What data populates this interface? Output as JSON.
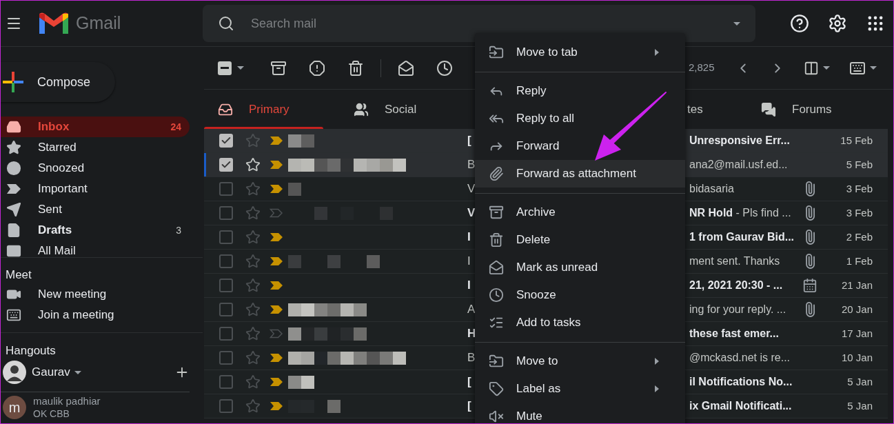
{
  "header": {
    "app_name": "Gmail",
    "search": {
      "placeholder": "Search mail"
    }
  },
  "compose": {
    "label": "Compose"
  },
  "nav": [
    {
      "label": "Inbox",
      "count": "24",
      "selected": true,
      "bold": true
    },
    {
      "label": "Starred",
      "selected": false,
      "bold": false
    },
    {
      "label": "Snoozed",
      "selected": false,
      "bold": false
    },
    {
      "label": "Important",
      "selected": false,
      "bold": false
    },
    {
      "label": "Sent",
      "selected": false,
      "bold": false
    },
    {
      "label": "Drafts",
      "count": "3",
      "selected": false,
      "bold": true
    },
    {
      "label": "All Mail",
      "selected": false,
      "bold": false
    }
  ],
  "meet": {
    "title": "Meet",
    "items": [
      {
        "label": "New meeting"
      },
      {
        "label": "Join a meeting"
      }
    ]
  },
  "hangouts": {
    "title": "Hangouts",
    "user": "Gaurav",
    "contacts": [
      {
        "name": "maulik padhiar",
        "status": "OK CBB",
        "initial": "m"
      }
    ]
  },
  "toolbar": {
    "partially_selected": true,
    "count": "2,825"
  },
  "tabs": [
    {
      "label": "Primary",
      "selected": true
    },
    {
      "label": "Social",
      "selected": false
    },
    {
      "label": "tes",
      "selected": false
    },
    {
      "label": "Forums",
      "selected": false
    }
  ],
  "emails": [
    {
      "checked": true,
      "focused": false,
      "important": true,
      "unread": true,
      "lead": "[",
      "text": "Unresponsive Err...",
      "date": "15 Feb"
    },
    {
      "checked": true,
      "focused": true,
      "important": true,
      "unread": false,
      "lead": "B",
      "text": "ana2@mail.usf.ed...",
      "date": "5 Feb"
    },
    {
      "checked": false,
      "focused": false,
      "important": true,
      "unread": false,
      "lead": "V",
      "text": "bidasaria",
      "has_attachment": true,
      "date": "3 Feb"
    },
    {
      "checked": false,
      "focused": false,
      "important": false,
      "unread": true,
      "lead": "V",
      "text": "NR Hold",
      "snippet": " - Pls find ...",
      "has_attachment": true,
      "date": "3 Feb"
    },
    {
      "checked": false,
      "focused": false,
      "important": true,
      "unread": true,
      "lead": "I",
      "text": "1 from Gaurav Bid...",
      "has_attachment": true,
      "date": "2 Feb"
    },
    {
      "checked": false,
      "focused": false,
      "important": true,
      "unread": false,
      "lead": "I",
      "text": "ment sent. Thanks",
      "has_attachment": true,
      "date": "1 Feb"
    },
    {
      "checked": false,
      "focused": false,
      "important": true,
      "unread": true,
      "lead": "I",
      "text": "21, 2021 20:30 - ...",
      "has_event": true,
      "date": "21 Jan"
    },
    {
      "checked": false,
      "focused": false,
      "important": true,
      "unread": false,
      "lead": "A",
      "text": "ing for your reply. ...",
      "has_attachment": true,
      "date": "20 Jan"
    },
    {
      "checked": false,
      "focused": false,
      "important": false,
      "unread": true,
      "lead": "H",
      "text": "these fast emer...",
      "date": "17 Jan"
    },
    {
      "checked": false,
      "focused": false,
      "important": true,
      "unread": false,
      "lead": "B",
      "text": "@mckasd.net is re...",
      "date": "10 Jan"
    },
    {
      "checked": false,
      "focused": false,
      "important": true,
      "unread": true,
      "lead": "[",
      "text": "il Notifications No...",
      "date": "5 Jan"
    },
    {
      "checked": false,
      "focused": false,
      "important": true,
      "unread": true,
      "lead": "[",
      "text": "ix Gmail Notificati...",
      "date": "5 Jan"
    }
  ],
  "context_menu": [
    {
      "kind": "item",
      "label": "Move to tab",
      "submenu": true,
      "highlighted": false
    },
    {
      "kind": "separator"
    },
    {
      "kind": "item",
      "label": "Reply",
      "submenu": false,
      "highlighted": false
    },
    {
      "kind": "item",
      "label": "Reply to all",
      "submenu": false,
      "highlighted": false
    },
    {
      "kind": "item",
      "label": "Forward",
      "submenu": false,
      "highlighted": false
    },
    {
      "kind": "item",
      "label": "Forward as attachment",
      "submenu": false,
      "highlighted": true
    },
    {
      "kind": "separator"
    },
    {
      "kind": "item",
      "label": "Archive",
      "submenu": false,
      "highlighted": false
    },
    {
      "kind": "item",
      "label": "Delete",
      "submenu": false,
      "highlighted": false
    },
    {
      "kind": "item",
      "label": "Mark as unread",
      "submenu": false,
      "highlighted": false
    },
    {
      "kind": "item",
      "label": "Snooze",
      "submenu": false,
      "highlighted": false
    },
    {
      "kind": "item",
      "label": "Add to tasks",
      "submenu": false,
      "highlighted": false
    },
    {
      "kind": "separator"
    },
    {
      "kind": "item",
      "label": "Move to",
      "submenu": true,
      "highlighted": false
    },
    {
      "kind": "item",
      "label": "Label as",
      "submenu": true,
      "highlighted": false
    },
    {
      "kind": "item",
      "label": "Mute",
      "submenu": false,
      "highlighted": false
    }
  ]
}
